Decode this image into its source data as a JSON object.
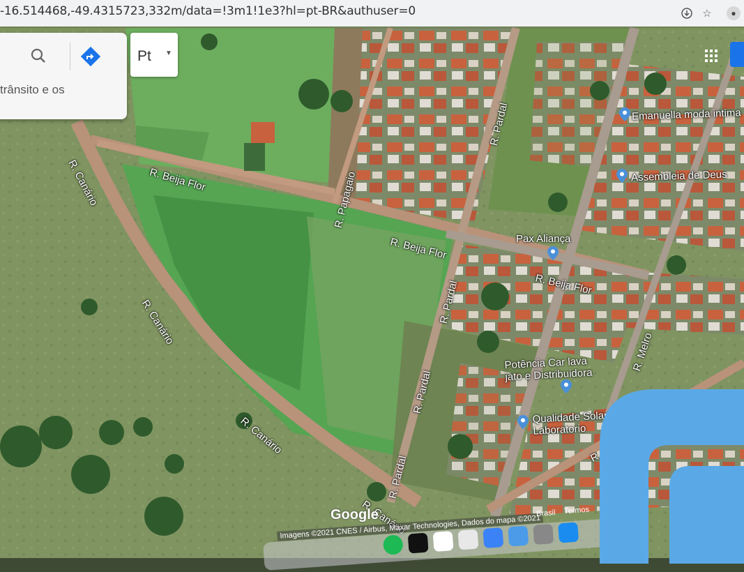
{
  "browser": {
    "url": "-16.514468,-49.4315723,332m/data=!3m1!1e3?hl=pt-BR&authuser=0",
    "icons": [
      "download-icon",
      "star-icon",
      "profile-icon"
    ]
  },
  "search_panel": {
    "hint_text": "trânsito e os",
    "icons": [
      "search-icon",
      "directions-icon"
    ]
  },
  "layer_button": {
    "label": "Pt",
    "icon": "chevron-down-icon"
  },
  "streets": {
    "beija_flor_1": "R. Beija Flor",
    "beija_flor_2": "R. Beija Flor",
    "beija_flor_3": "R. Beija Flor",
    "canario_1": "R. Canário",
    "canario_2": "R. Canário",
    "canario_3": "R. Canário",
    "canario_4": "R. Canário",
    "papagaio": "R. Papagaio",
    "pardal_1": "R. Pardal",
    "pardal_2": "R. Pardal",
    "pardal_3": "R. Pardal",
    "pardal_4": "R. Pardal",
    "melro": "R. Melro",
    "bem_te_vi": "R. Bem-te-vi",
    "partial_right": "urio"
  },
  "places": {
    "emanuella": "Emanuella moda intima",
    "assembleia": "Assembleia de Deus",
    "pax": "Pax Aliança",
    "potencia_1": "Potência Car lava",
    "potencia_2": "jato e Distribuidora",
    "qualidade_1": "Qualidade Solar",
    "qualidade_2": "Laboratorio"
  },
  "map_branding": {
    "google": "Google",
    "attribution": "Imagens ©2021 CNES / Airbus, Maxar Technologies, Dados do mapa ©2021",
    "country": "Brasil",
    "terms": "Termos"
  },
  "dock_apps": [
    "spotify",
    "apple-tv",
    "photos",
    "preview",
    "keynote",
    "finder",
    "app-store",
    "chrome"
  ],
  "colors": {
    "grass_dark": "#6f8c55",
    "grass_bright": "#5aa855",
    "dirt_road": "#b9927a",
    "pin_blue": "#4a90d9",
    "logo_blue": "#5aa9e6",
    "google_blue": "#1a73e8"
  }
}
